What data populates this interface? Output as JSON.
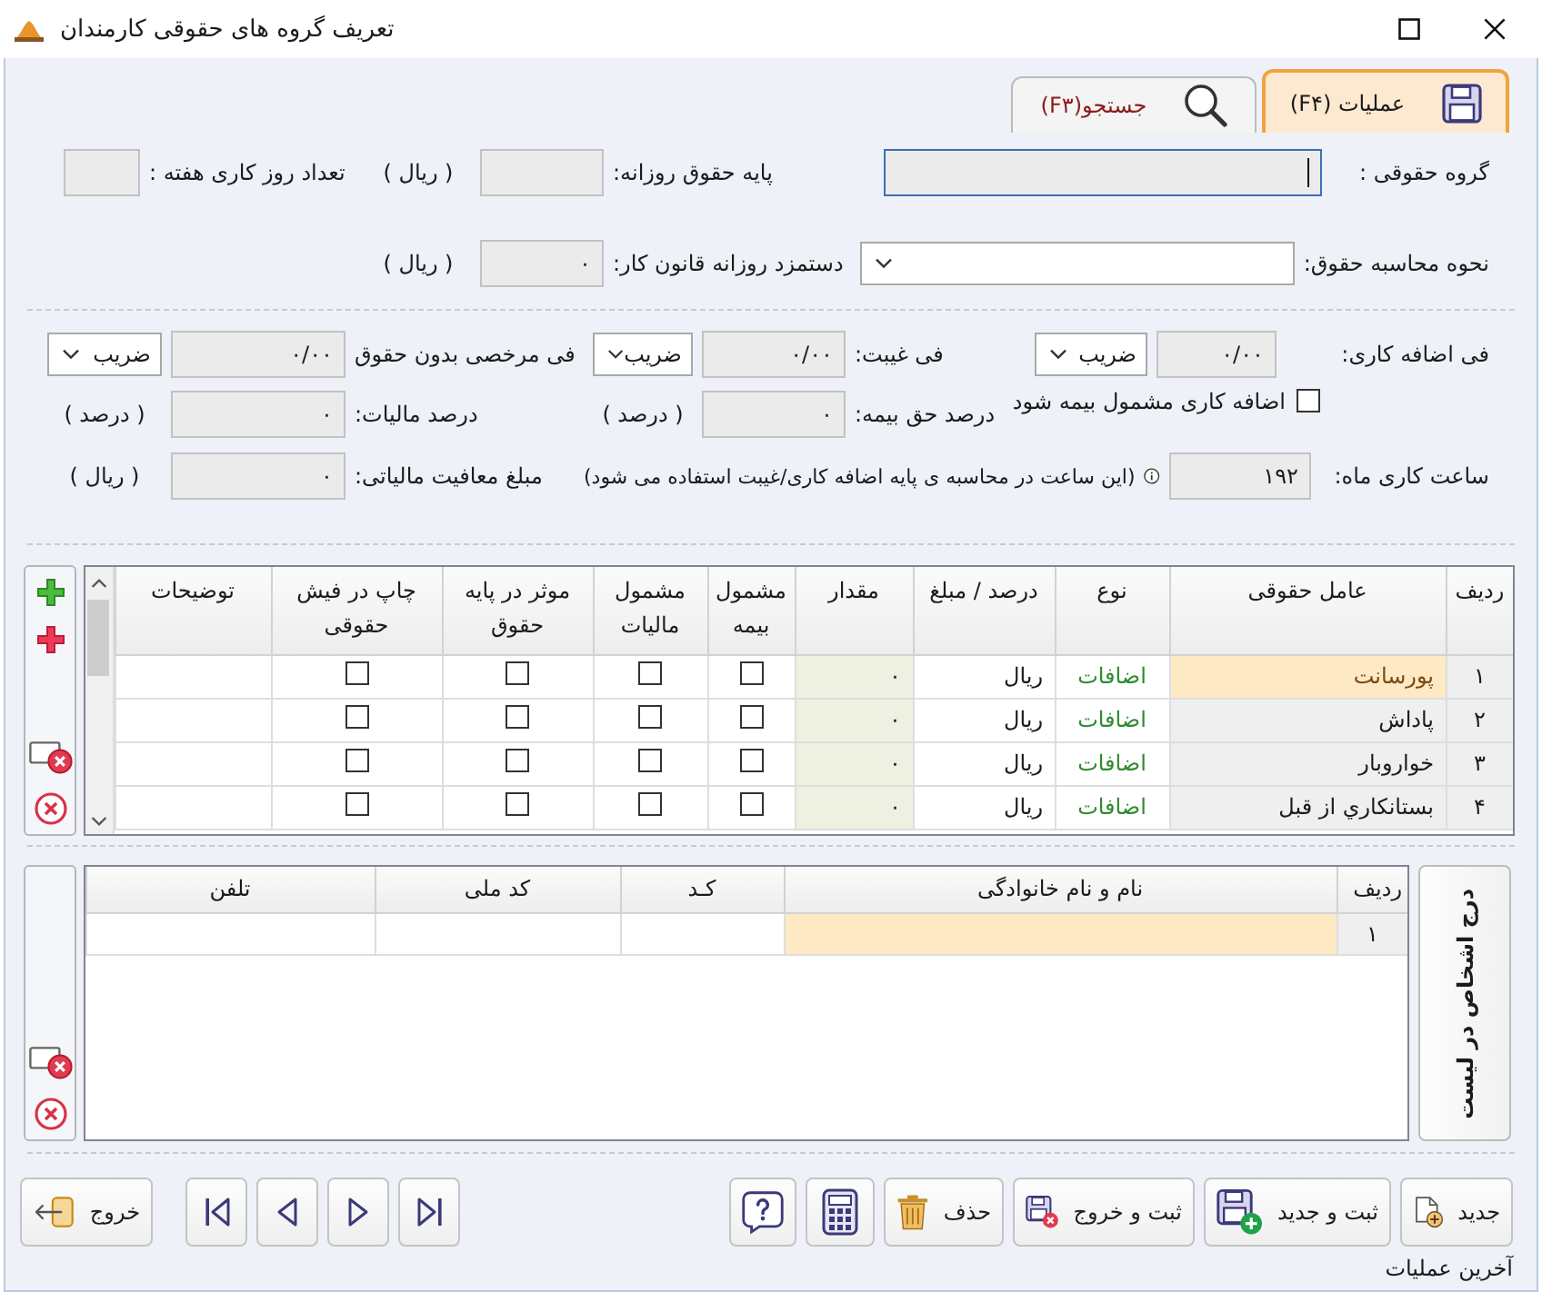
{
  "window": {
    "title": "تعریف گروه های حقوقی کارمندان"
  },
  "tabs": [
    {
      "label": "عملیات (F۴)",
      "selected": true
    },
    {
      "label": "جستجو(F۳)",
      "selected": false
    }
  ],
  "header_rows": [
    [
      {
        "kind": "text",
        "label": "گروه حقوقی :",
        "focused": true
      },
      {
        "kind": "text",
        "label": "پایه حقوق روزانه:",
        "unit": "( ریال )",
        "focused": false
      },
      {
        "kind": "text",
        "label": "تعداد روز کاری هفته :",
        "focused": false
      }
    ],
    [
      {
        "kind": "combo",
        "label": "نحوه محاسبه حقوق:",
        "focused": false
      },
      {
        "kind": "text",
        "label": "دستمزد روزانه قانون کار:",
        "value": "۰",
        "unit": "( ریال )",
        "focused": false
      }
    ]
  ],
  "rate_rows": [
    [
      {
        "kind": "rate",
        "label": "فی اضافه کاری:",
        "value": "۰/۰۰",
        "mode": "ضریب"
      },
      {
        "kind": "rate",
        "label": "فی غیبت:",
        "value": "۰/۰۰",
        "mode": "ضریب"
      },
      {
        "kind": "rate",
        "label": "فی مرخصی بدون حقوق",
        "value": "۰/۰۰",
        "mode": "ضریب"
      }
    ],
    [
      {
        "kind": "check",
        "label": "اضافه کاری مشمول بیمه شود",
        "checked": false
      },
      {
        "kind": "text",
        "label": "درصد حق بیمه:",
        "value": "۰",
        "unit": "( درصد )"
      },
      {
        "kind": "text",
        "label": "درصد مالیات:",
        "value": "۰",
        "unit": "( درصد )"
      }
    ],
    [
      {
        "kind": "text",
        "label": "ساعت کاری ماه:",
        "value": "۱۹۲",
        "note": "(این ساعت در محاسبه ی پایه اضافه کاری/غیبت استفاده می شود)"
      },
      {
        "kind": "text",
        "label": "مبلغ معافیت مالیاتی:",
        "value": "۰",
        "unit": "( ریال )"
      }
    ]
  ],
  "earnings_table": {
    "columns": [
      "ردیف",
      "عامل حقوقی",
      "نوع",
      "درصد / مبلغ",
      "مقدار",
      "مشمول بیمه",
      "مشمول مالیات",
      "موثر در پایه حقوق",
      "چاپ در فیش حقوقی",
      "توضیحات"
    ],
    "rows": [
      {
        "row": "۱",
        "name": "پورسانت",
        "type": "اضافات",
        "basis": "ریال",
        "amount": "۰",
        "insured": false,
        "taxable": false,
        "affects_base": false,
        "on_payslip": false,
        "selected": true
      },
      {
        "row": "۲",
        "name": "پاداش",
        "type": "اضافات",
        "basis": "ریال",
        "amount": "۰",
        "insured": false,
        "taxable": false,
        "affects_base": false,
        "on_payslip": false,
        "selected": false
      },
      {
        "row": "۳",
        "name": "خواروبار",
        "type": "اضافات",
        "basis": "ریال",
        "amount": "۰",
        "insured": false,
        "taxable": false,
        "affects_base": false,
        "on_payslip": false,
        "selected": false
      },
      {
        "row": "۴",
        "name": "بستانکاري از قبل",
        "type": "اضافات",
        "basis": "ریال",
        "amount": "۰",
        "insured": false,
        "taxable": false,
        "affects_base": false,
        "on_payslip": false,
        "selected": false
      }
    ]
  },
  "persons_table": {
    "side_button": "درج اشخاص در لیست",
    "columns": [
      "ردیف",
      "نام و نام خانوادگی",
      "کـد",
      "کد ملی",
      "تلفن"
    ],
    "rows": [
      {
        "row": "۱",
        "selected": true
      }
    ]
  },
  "toolbar": [
    {
      "kind": "new",
      "label": "جدید"
    },
    {
      "kind": "save_new",
      "label": "ثبت و جدید"
    },
    {
      "kind": "save_exit",
      "label": "ثبت و خروج"
    },
    {
      "kind": "delete",
      "label": "حذف"
    },
    {
      "kind": "calculator"
    },
    {
      "kind": "help"
    },
    {
      "kind": "nav_end_right"
    },
    {
      "kind": "nav_right"
    },
    {
      "kind": "nav_left"
    },
    {
      "kind": "nav_end_left"
    },
    {
      "kind": "exit",
      "label": "خروج"
    }
  ],
  "status_bar": {
    "text": "آخرین عملیات"
  }
}
